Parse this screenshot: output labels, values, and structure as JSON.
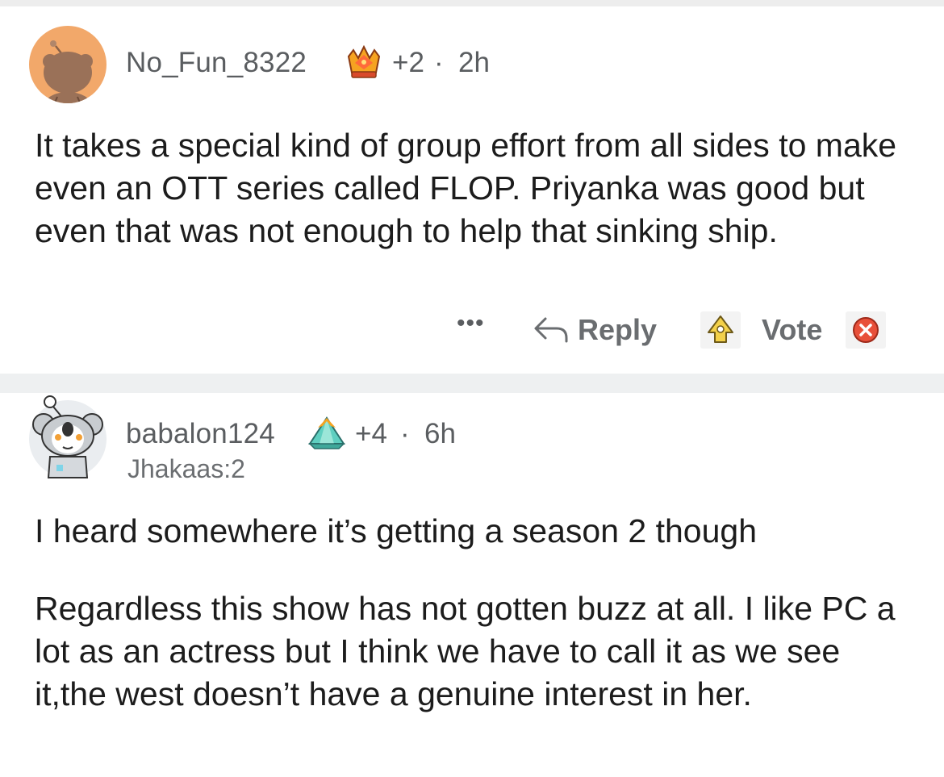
{
  "comment1": {
    "username": "No_Fun_8322",
    "score": "+2",
    "separator": "·",
    "age": "2h",
    "award_icon": "crown-award-icon",
    "paragraphs": [
      "It takes a special kind of group effort from all sides to make even an OTT series called FLOP. Priyanka was good but even that was not enough to help that sinking ship."
    ],
    "actions": {
      "more": "•••",
      "reply": "Reply",
      "vote": "Vote"
    }
  },
  "comment2": {
    "username": "babalon124",
    "score": "+4",
    "separator": "·",
    "age": "6h",
    "flair": "Jhakaas:2",
    "award_icon": "pyramid-award-icon",
    "paragraphs": [
      "I heard somewhere it’s getting a season 2 though",
      "Regardless this show has not gotten buzz at all. I like PC a lot as an actress but I think we have to call it as we see it,the west doesn’t have a genuine interest in her."
    ]
  },
  "colors": {
    "avatar1_bg": "#f2a86a",
    "avatar2_bg": "#eaedf0",
    "meta_text": "#5a5d60",
    "body_text": "#1c1c1c",
    "divider": "#eef0f1",
    "downvote_red": "#e8503a"
  }
}
